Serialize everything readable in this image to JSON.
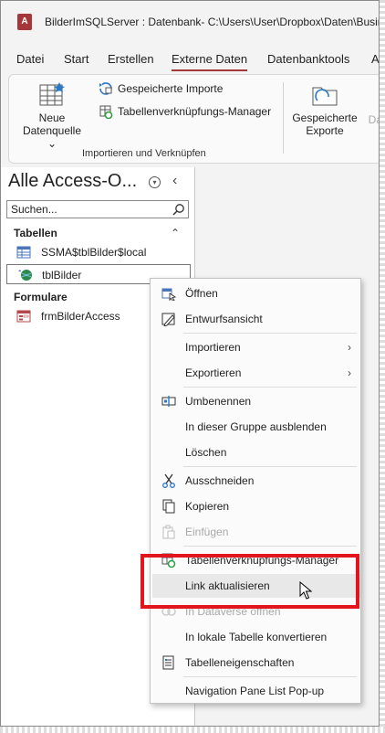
{
  "titlebar": {
    "title": "BilderImSQLServer : Datenbank- C:\\Users\\User\\Dropbox\\Daten\\Busin",
    "app_icon": "A"
  },
  "ribbon_tabs": [
    "Datei",
    "Start",
    "Erstellen",
    "Externe Daten",
    "Datenbanktools",
    "A"
  ],
  "ribbon": {
    "new_source_line1": "Neue",
    "new_source_line2": "Datenquelle",
    "saved_imports": "Gespeicherte Importe",
    "linked_table_manager": "Tabellenverknüpfungs-Manager",
    "group_label": "Importieren und Verknüpfen",
    "saved_exports_line1": "Gespeicherte",
    "saved_exports_line2": "Exporte",
    "cut_label": "Dat"
  },
  "nav": {
    "title": "Alle Access-O...",
    "search_placeholder": "Suchen...",
    "section_tables": "Tabellen",
    "table_items": [
      "SSMA$tblBilder$local",
      "tblBilder"
    ],
    "section_forms": "Formulare",
    "form_items": [
      "frmBilderAccess"
    ]
  },
  "context_menu": {
    "items": [
      {
        "label": "Öffnen",
        "icon": "open-icon",
        "disabled": false
      },
      {
        "label": "Entwurfsansicht",
        "icon": "design-view-icon",
        "disabled": false
      },
      {
        "label": "Importieren",
        "icon": "",
        "disabled": false,
        "submenu": true
      },
      {
        "label": "Exportieren",
        "icon": "",
        "disabled": false,
        "submenu": true
      },
      {
        "label": "Umbenennen",
        "icon": "rename-icon",
        "disabled": false
      },
      {
        "label": "In dieser Gruppe ausblenden",
        "icon": "",
        "disabled": false
      },
      {
        "label": "Löschen",
        "icon": "",
        "disabled": false
      },
      {
        "label": "Ausschneiden",
        "icon": "cut-icon",
        "disabled": false
      },
      {
        "label": "Kopieren",
        "icon": "copy-icon",
        "disabled": false
      },
      {
        "label": "Einfügen",
        "icon": "paste-icon",
        "disabled": true
      },
      {
        "label": "Tabellenverknüpfungs-Manager",
        "icon": "linked-table-icon",
        "disabled": false
      },
      {
        "label": "Link aktualisieren",
        "icon": "",
        "disabled": false
      },
      {
        "label": "In Dataverse öffnen",
        "icon": "dataverse-icon",
        "disabled": true
      },
      {
        "label": "In lokale Tabelle konvertieren",
        "icon": "",
        "disabled": false
      },
      {
        "label": "Tabelleneigenschaften",
        "icon": "properties-icon",
        "disabled": false
      },
      {
        "label": "Navigation Pane List Pop-up",
        "icon": "",
        "disabled": false
      }
    ]
  },
  "colors": {
    "accent": "#a4373a",
    "highlight": "#e3141c"
  }
}
